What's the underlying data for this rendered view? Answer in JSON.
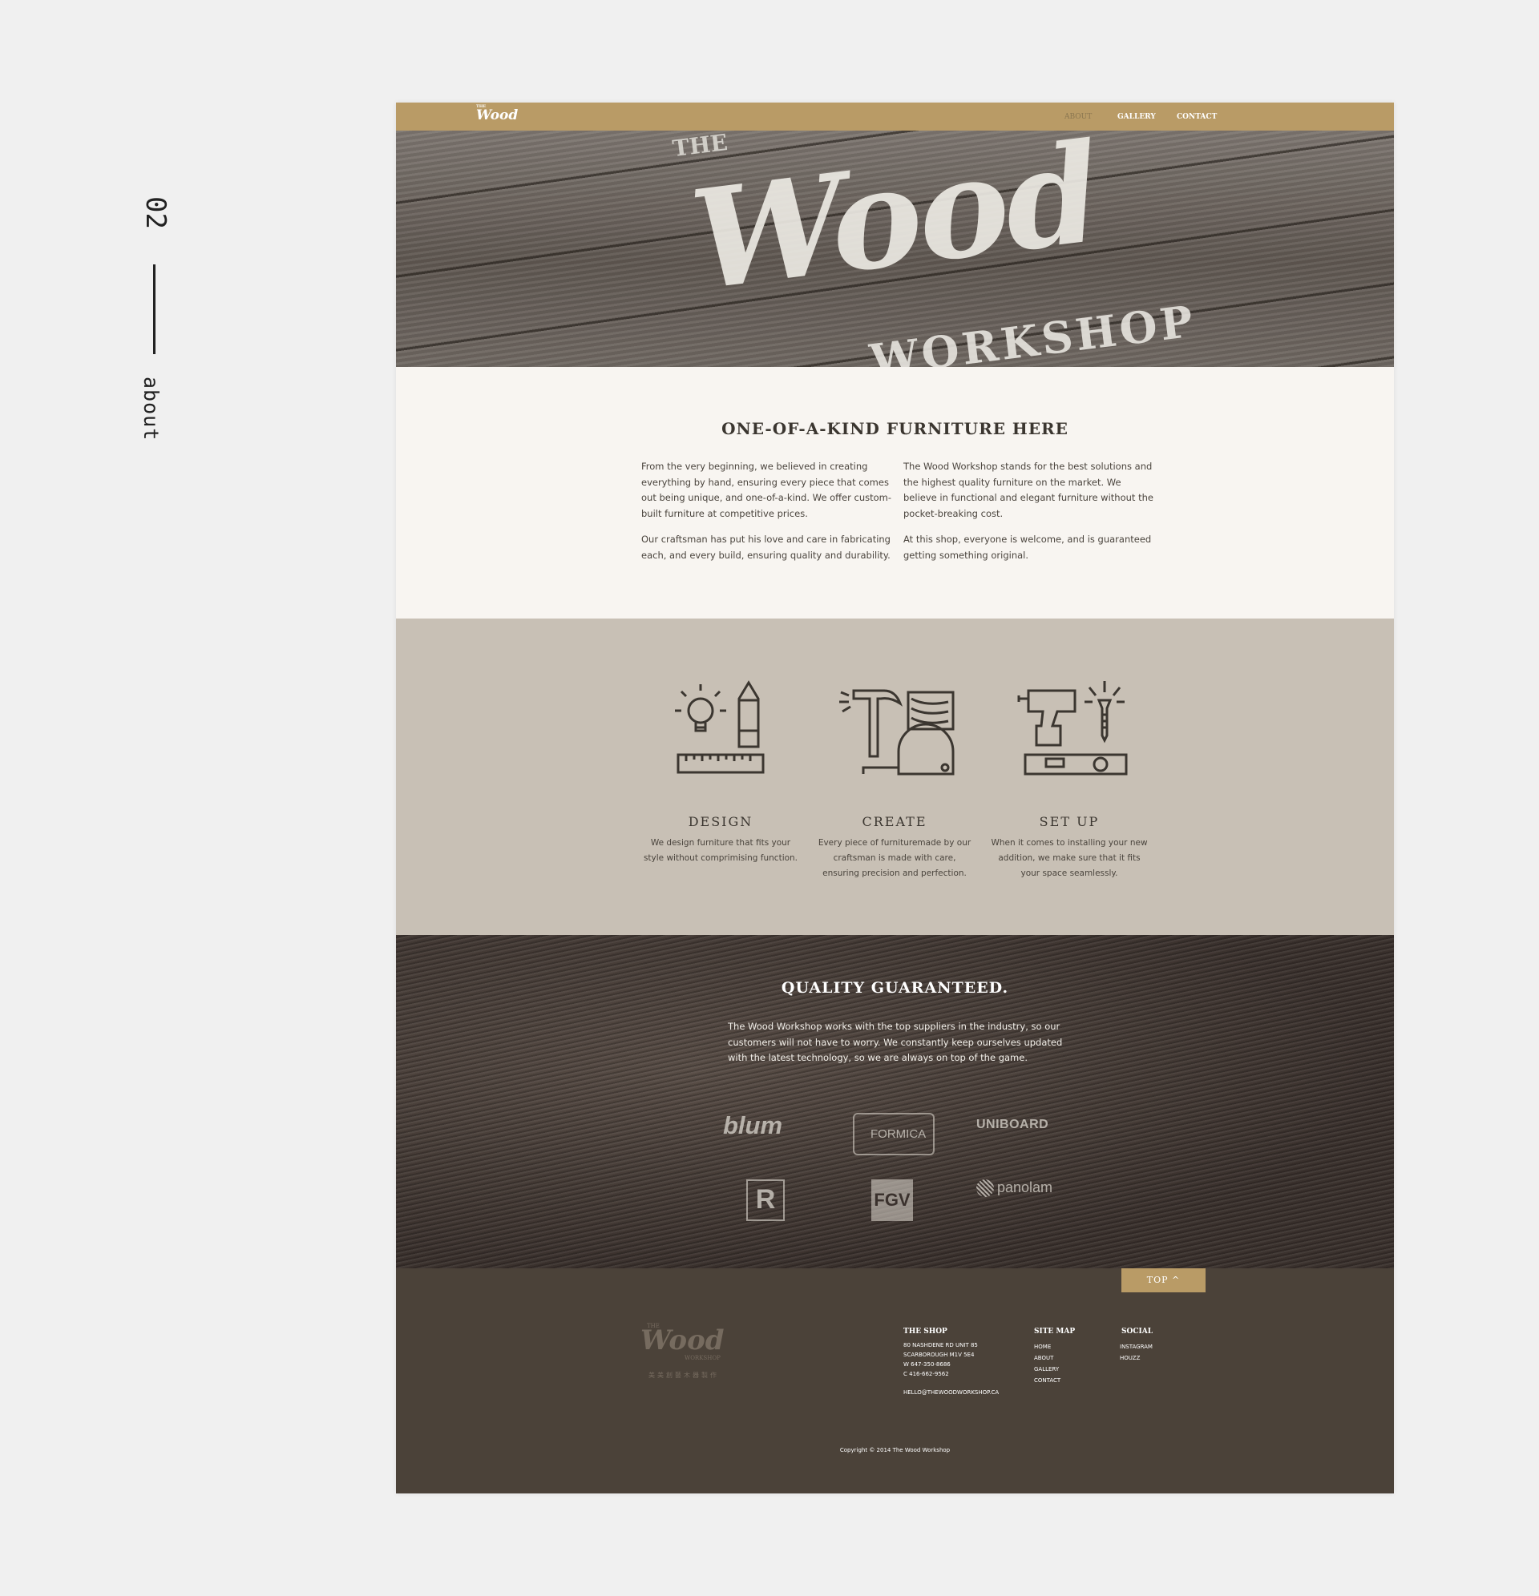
{
  "side": {
    "number": "02",
    "label": "about"
  },
  "nav": {
    "logo": "Wood",
    "logo_the": "THE",
    "items": [
      "ABOUT",
      "GALLERY",
      "CONTACT"
    ]
  },
  "hero": {
    "the": "THE",
    "title": "Wood",
    "subtitle": "WORKSHOP"
  },
  "intro": {
    "title": "ONE-OF-A-KIND FURNITURE HERE",
    "left": [
      "From the very beginning, we believed in creating everything by hand, ensuring every piece that comes out being unique, and one-of-a-kind. We offer custom-built furniture at competitive prices.",
      "Our craftsman has put his love and care in fabricating each, and every build, ensuring quality and durability."
    ],
    "right": [
      "The Wood Workshop stands for the best solutions and the highest quality furniture on the market. We believe in functional and elegant furniture without the pocket-breaking cost.",
      "At this shop, everyone is welcome, and is guaranteed getting something original."
    ]
  },
  "services": [
    {
      "icon": "design-tools-icon",
      "title": "DESIGN",
      "desc": "We design furniture that fits your style without comprimising function."
    },
    {
      "icon": "create-tools-icon",
      "title": "CREATE",
      "desc": "Every piece of furnituremade by our craftsman is made with care, ensuring precision and perfection."
    },
    {
      "icon": "setup-tools-icon",
      "title": "SET UP",
      "desc": "When it comes to installing your new addition, we make sure that it fits your space seamlessly."
    }
  ],
  "quality": {
    "title": "QUALITY GUARANTEED.",
    "text": "The Wood Workshop works with the top suppliers in the industry, so our customers will not have to worry. We constantly keep ourselves updated with the latest technology, so we are always on top of the game.",
    "logos": {
      "blum": "blum",
      "formica": "FORMICA",
      "uniboard": "UNIBOARD",
      "r": "R",
      "fgv": "FGV",
      "panolam": "panolam"
    }
  },
  "footer": {
    "top_button": "TOP ^",
    "logo": "Wood",
    "logo_the": "THE",
    "logo_workshop": "WORKSHOP",
    "logo_cn": "美美創藝木器製作",
    "shop": {
      "heading": "THE SHOP",
      "address1": "80 NASHDENE RD     UNIT 85",
      "address2": "SCARBOROUGH     M1V 5E4",
      "work": "W    647-350-8686",
      "cell": "C    416-662-9562",
      "email": "HELLO@THEWOODWORKSHOP.CA"
    },
    "sitemap": {
      "heading": "SITE MAP",
      "links": [
        "HOME",
        "ABOUT",
        "GALLERY",
        "CONTACT"
      ]
    },
    "social": {
      "heading": "SOCIAL",
      "links": [
        "INSTAGRAM",
        "HOUZZ"
      ]
    },
    "copyright": "Copyright © 2014 The Wood Workshop"
  },
  "colors": {
    "accent": "#b99b66",
    "footer": "#4b4239",
    "services_bg": "#c8c0b5",
    "page_bg": "#f0f0f0",
    "ink": "#3b3630"
  }
}
